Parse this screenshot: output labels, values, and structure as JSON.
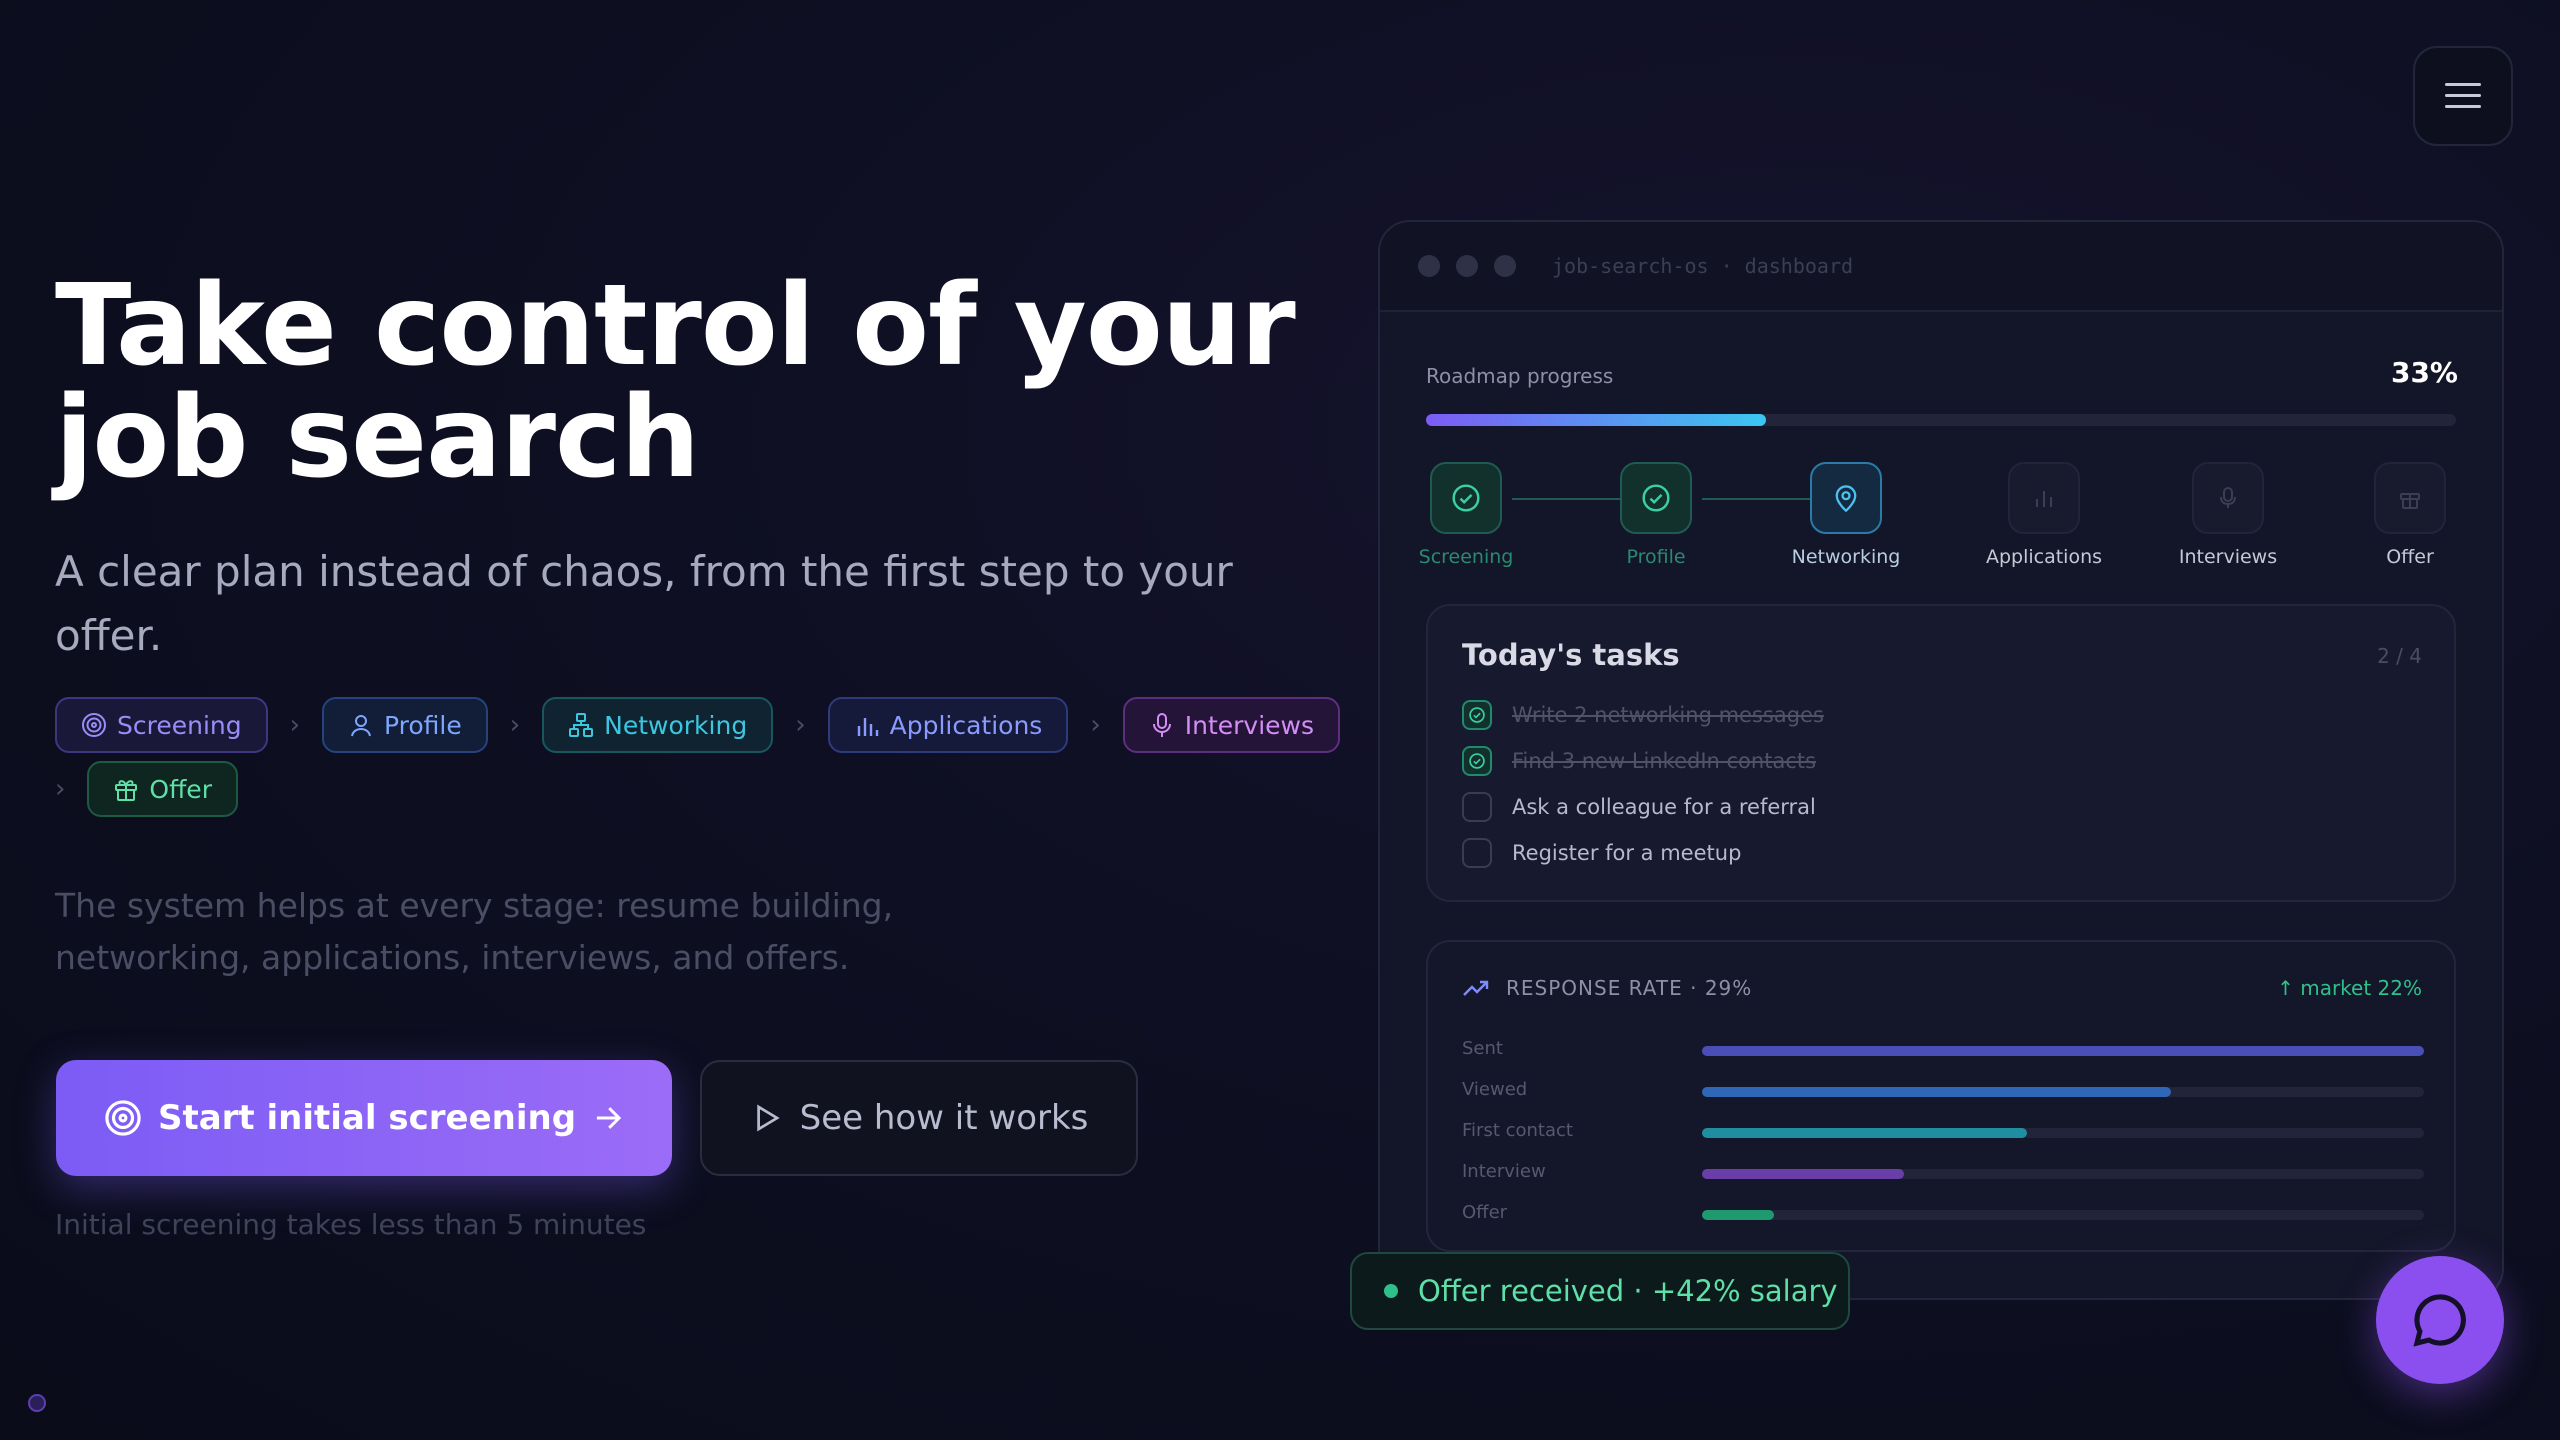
{
  "hero": {
    "title_line1": "Take control of your",
    "title_line2": "job search",
    "subtitle": "A clear plan instead of chaos, from the first step to your offer.",
    "description": "The system helps at every stage: resume building, networking, applications, interviews, and offers.",
    "pills": [
      {
        "label": "Screening",
        "icon": "target-icon",
        "color": "#9b8cf7"
      },
      {
        "label": "Profile",
        "icon": "user-icon",
        "color": "#7ea6ff"
      },
      {
        "label": "Networking",
        "icon": "network-icon",
        "color": "#3cc6e0"
      },
      {
        "label": "Applications",
        "icon": "bar-chart-icon",
        "color": "#8a9bff"
      },
      {
        "label": "Interviews",
        "icon": "mic-icon",
        "color": "#d48cf7"
      },
      {
        "label": "Offer",
        "icon": "gift-icon",
        "color": "#5ee0a8"
      }
    ],
    "cta_primary": "Start initial screening",
    "cta_secondary": "See how it works",
    "cta_note": "Initial screening takes less than 5 minutes"
  },
  "dashboard": {
    "window_title": "job-search-os · dashboard",
    "progress_label": "Roadmap progress",
    "progress_value_text": "33%",
    "progress_fraction": 0.33,
    "steps": [
      {
        "label": "Screening",
        "state": "done"
      },
      {
        "label": "Profile",
        "state": "done"
      },
      {
        "label": "Networking",
        "state": "active"
      },
      {
        "label": "Applications",
        "state": "pending"
      },
      {
        "label": "Interviews",
        "state": "pending"
      },
      {
        "label": "Offer",
        "state": "pending"
      }
    ],
    "tasks": {
      "title": "Today's tasks",
      "count": "2 / 4",
      "items": [
        {
          "label": "Write 2 networking messages",
          "done": true
        },
        {
          "label": "Find 3 new LinkedIn contacts",
          "done": true
        },
        {
          "label": "Ask a colleague for a referral",
          "done": false
        },
        {
          "label": "Register for a meetup",
          "done": false
        }
      ]
    },
    "response": {
      "title": "RESPONSE RATE · 29%",
      "market": "↑ market 22%",
      "rows": [
        {
          "label": "Sent",
          "value": 1.0,
          "color": "#4a4fb8"
        },
        {
          "label": "Viewed",
          "value": 0.65,
          "color": "#2f66b8"
        },
        {
          "label": "First contact",
          "value": 0.45,
          "color": "#1f8ea0"
        },
        {
          "label": "Interview",
          "value": 0.28,
          "color": "#6a3ea8"
        },
        {
          "label": "Offer",
          "value": 0.1,
          "color": "#1f9a6e"
        }
      ]
    }
  },
  "toast": {
    "text": "Offer received · +42% salary"
  },
  "colors": {
    "accent": "#7c5cf5",
    "success": "#2fbf8a",
    "chat": "#8b4ff0"
  }
}
